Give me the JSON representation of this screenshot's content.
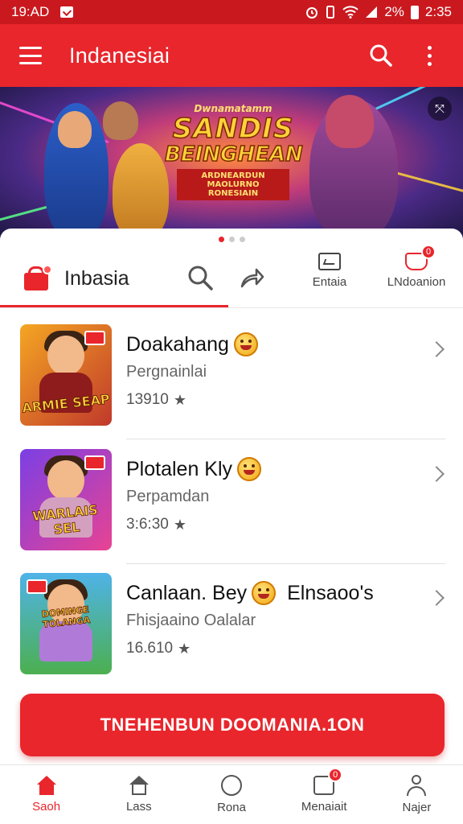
{
  "status_bar": {
    "time_left": "19:AD",
    "battery_text": "2%",
    "time_right": "2:35"
  },
  "app_bar": {
    "title": "Indanesiai"
  },
  "banner": {
    "small_line": "Dwnamatamm",
    "title_line1": "SANDIS",
    "title_line2": "BEINGHEAN",
    "ribbon_line1": "ARDNEARDUN MAOLURNO",
    "ribbon_line2": "RONESIAIN"
  },
  "section": {
    "label": "Inbasia",
    "tool_entries_label": "Entaia",
    "tool_notifications_label": "LNdoanion",
    "notifications_count": "0"
  },
  "items": [
    {
      "title": "Doakahang",
      "subtitle": "Pergnainlai",
      "rating": "13910",
      "thumb_caption": "ARMIE SEAP",
      "colors": {
        "bg1": "#f5a623",
        "bg2": "#c0392b",
        "body": "#8e1c1c"
      }
    },
    {
      "title": "Plotalen Kly",
      "subtitle": "Perpamdan",
      "rating": "3:6:30",
      "thumb_caption": "WARLAIS SEL",
      "colors": {
        "bg1": "#7b3fe4",
        "bg2": "#e84393",
        "body": "#d4a0c0"
      }
    },
    {
      "title": "Canlaan. Bey",
      "title_suffix": "Elnsaoo's",
      "subtitle": "Fhisjaaino Oalalar",
      "rating": "16.610",
      "thumb_caption": "DOMINGE TOLANGA",
      "colors": {
        "bg1": "#4fb3e8",
        "bg2": "#4caf50",
        "body": "#b07bd8"
      }
    }
  ],
  "cta": {
    "label": "TNEHENBUN DOOMANIA.1ON"
  },
  "bottom_nav": [
    {
      "label": "Saoh",
      "active": true
    },
    {
      "label": "Lass"
    },
    {
      "label": "Rona"
    },
    {
      "label": "Menaiait",
      "badge": "0"
    },
    {
      "label": "Najer"
    }
  ],
  "colors": {
    "primary": "#e8262c",
    "status_bar": "#c9191f"
  }
}
